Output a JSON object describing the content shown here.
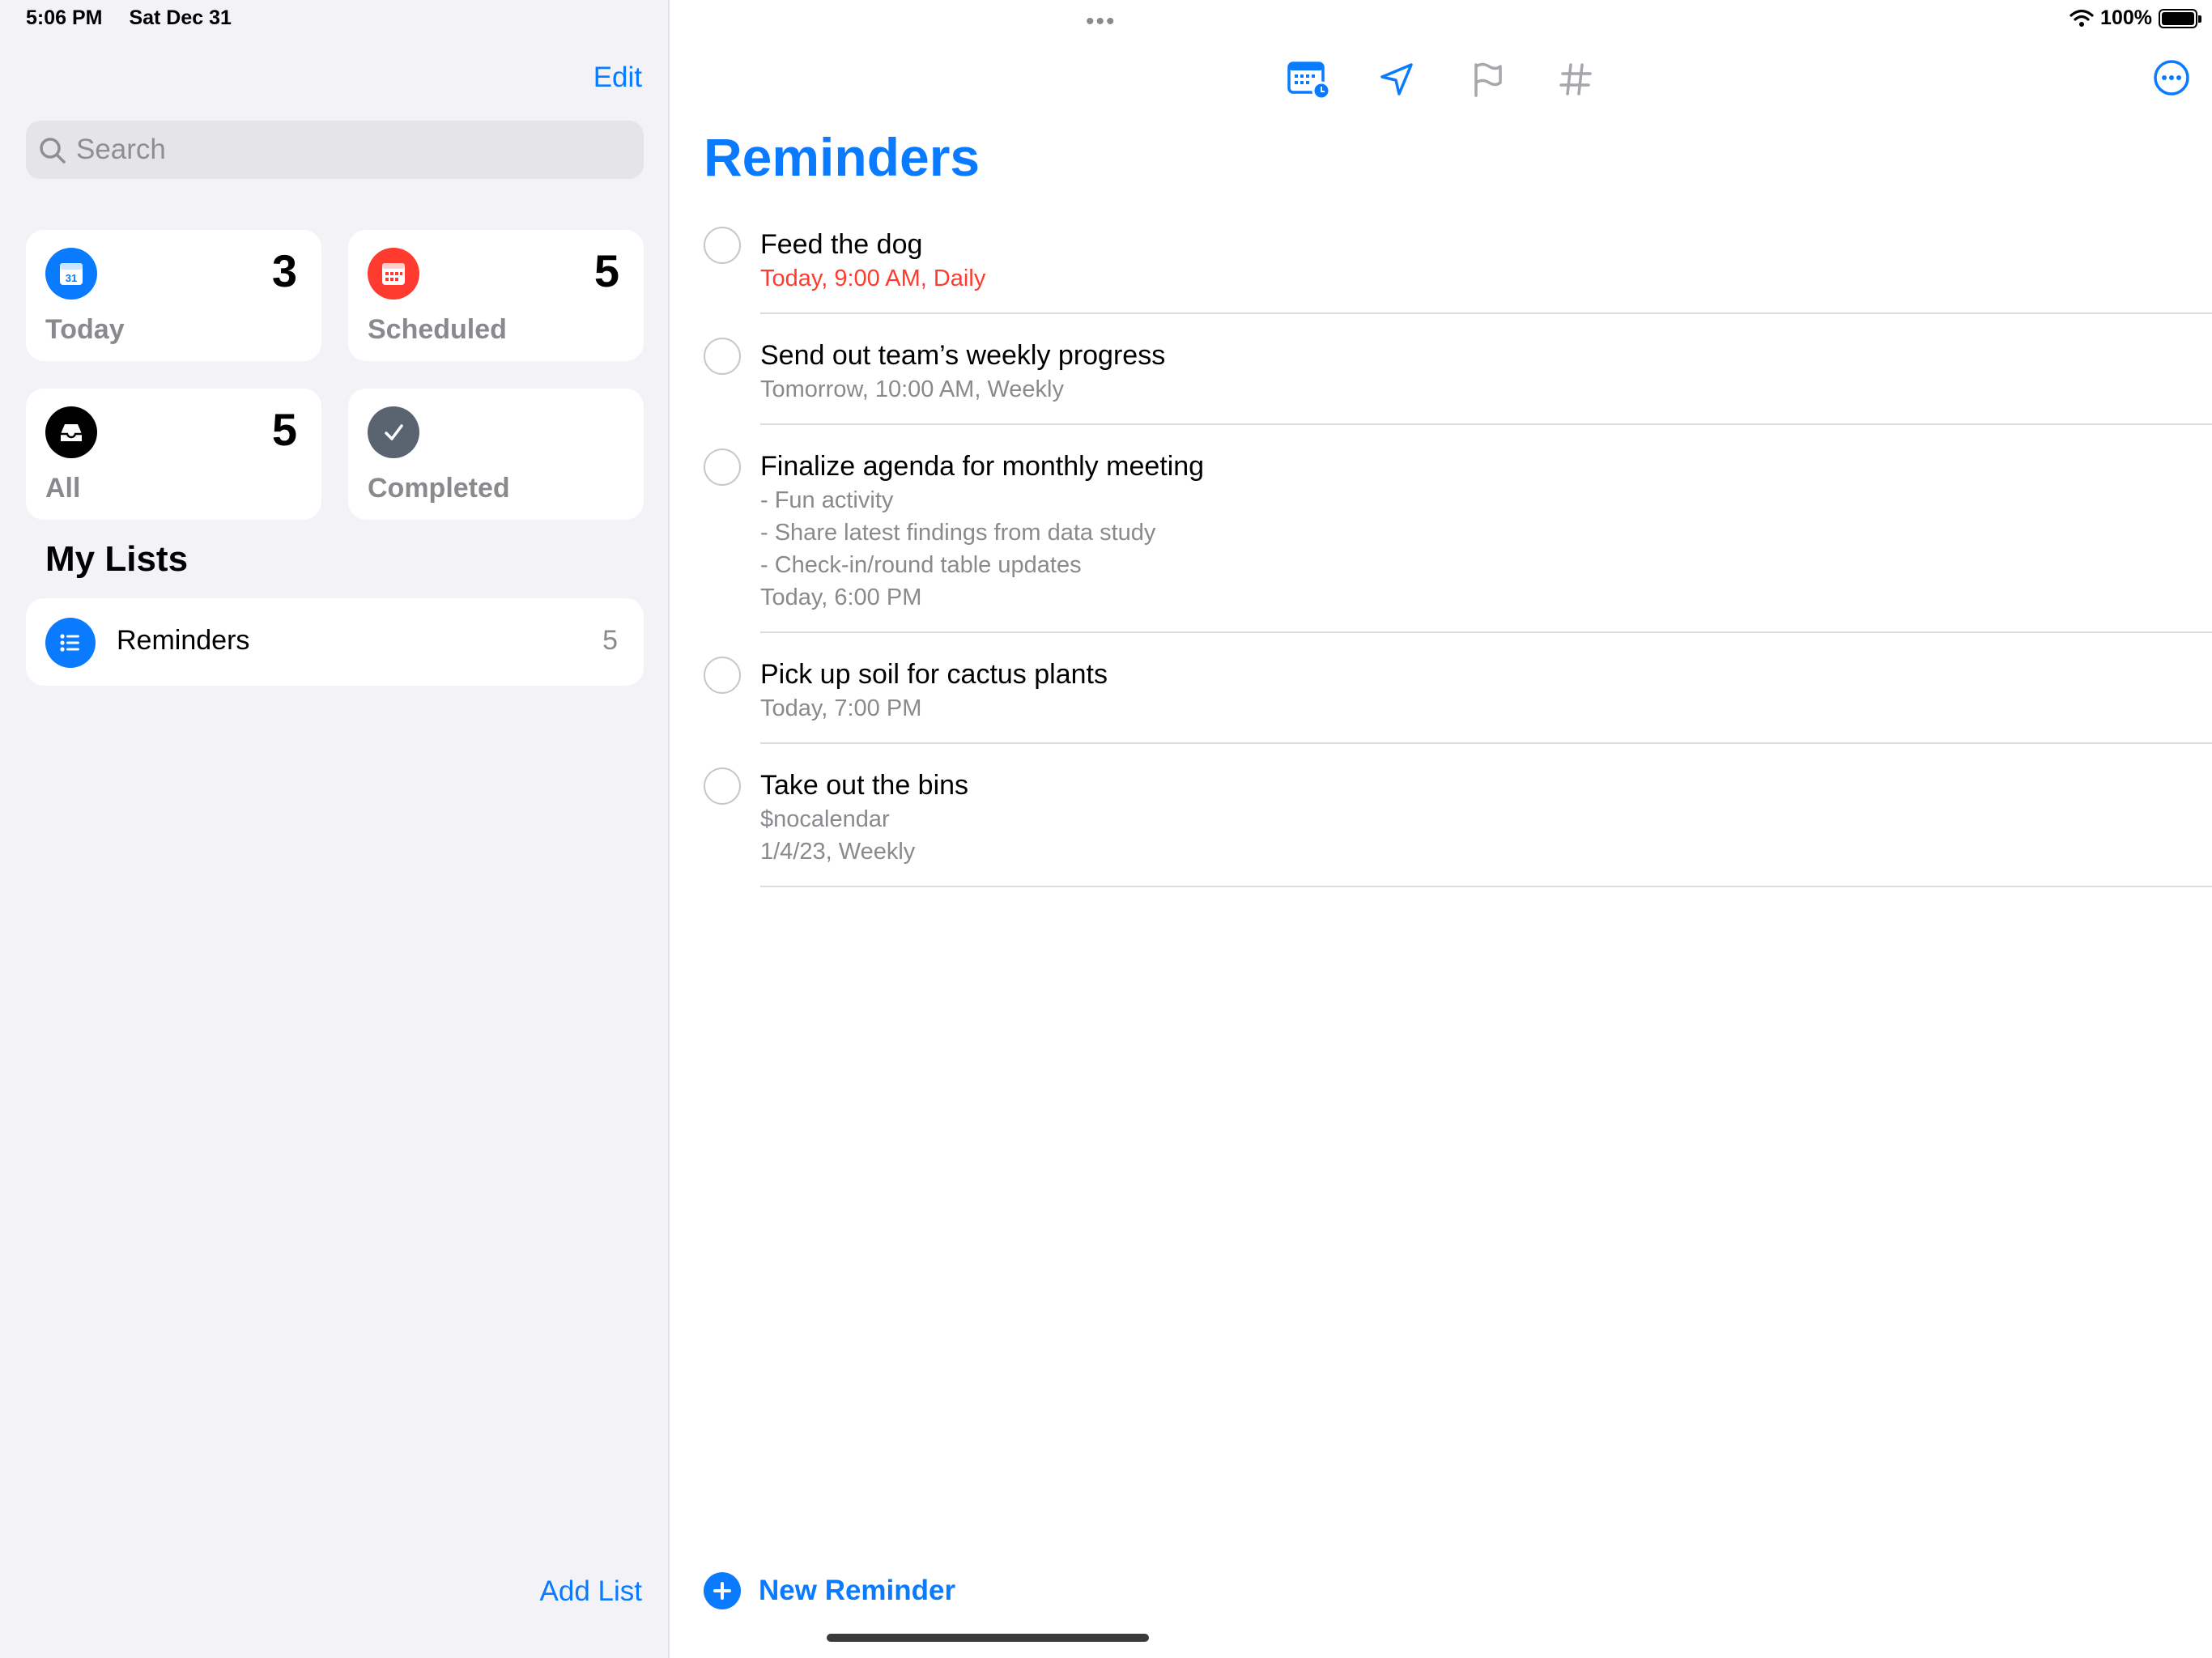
{
  "status_bar": {
    "time": "5:06 PM",
    "date": "Sat Dec 31",
    "battery": "100%",
    "battery_level": 1.0
  },
  "sidebar": {
    "edit_label": "Edit",
    "search_placeholder": "Search",
    "smart_lists": [
      {
        "label": "Today",
        "count": "3",
        "icon": "calendar-icon",
        "color": "#0a7aff",
        "date_text": "31"
      },
      {
        "label": "Scheduled",
        "count": "5",
        "icon": "calendar-grid-icon",
        "color": "#ff3b30"
      },
      {
        "label": "All",
        "count": "5",
        "icon": "tray-icon",
        "color": "#000000"
      },
      {
        "label": "Completed",
        "count": "",
        "icon": "checkmark-icon",
        "color": "#5a6370"
      }
    ],
    "my_lists_heading": "My Lists",
    "lists": [
      {
        "name": "Reminders",
        "count": "5",
        "icon": "list-icon",
        "color": "#0a7aff"
      }
    ],
    "add_list_label": "Add List"
  },
  "main": {
    "toolbar_icons": [
      "date-time-icon",
      "location-arrow-icon",
      "flag-icon",
      "hashtag-icon"
    ],
    "more_icon": "ellipsis-circle-icon",
    "title": "Reminders",
    "reminders": [
      {
        "title": "Feed the dog",
        "lines": [
          "Today, 9:00 AM, Daily"
        ],
        "overdue": true
      },
      {
        "title": "Send out team’s weekly progress",
        "lines": [
          "Tomorrow, 10:00 AM, Weekly"
        ],
        "overdue": false
      },
      {
        "title": "Finalize agenda for monthly meeting",
        "lines": [
          "- Fun activity",
          "- Share latest findings from data study",
          "- Check-in/round table updates",
          "Today, 6:00 PM"
        ],
        "overdue": false
      },
      {
        "title": "Pick up soil for cactus plants",
        "lines": [
          "Today, 7:00 PM"
        ],
        "overdue": false
      },
      {
        "title": "Take out the bins",
        "lines": [
          "$nocalendar",
          "1/4/23, Weekly"
        ],
        "overdue": false
      }
    ],
    "new_reminder_label": "New Reminder"
  },
  "colors": {
    "accent": "#0a7aff",
    "overdue": "#ff3b30",
    "sidebar_bg": "#f2f2f7",
    "secondary_text": "#8a8a8e"
  }
}
